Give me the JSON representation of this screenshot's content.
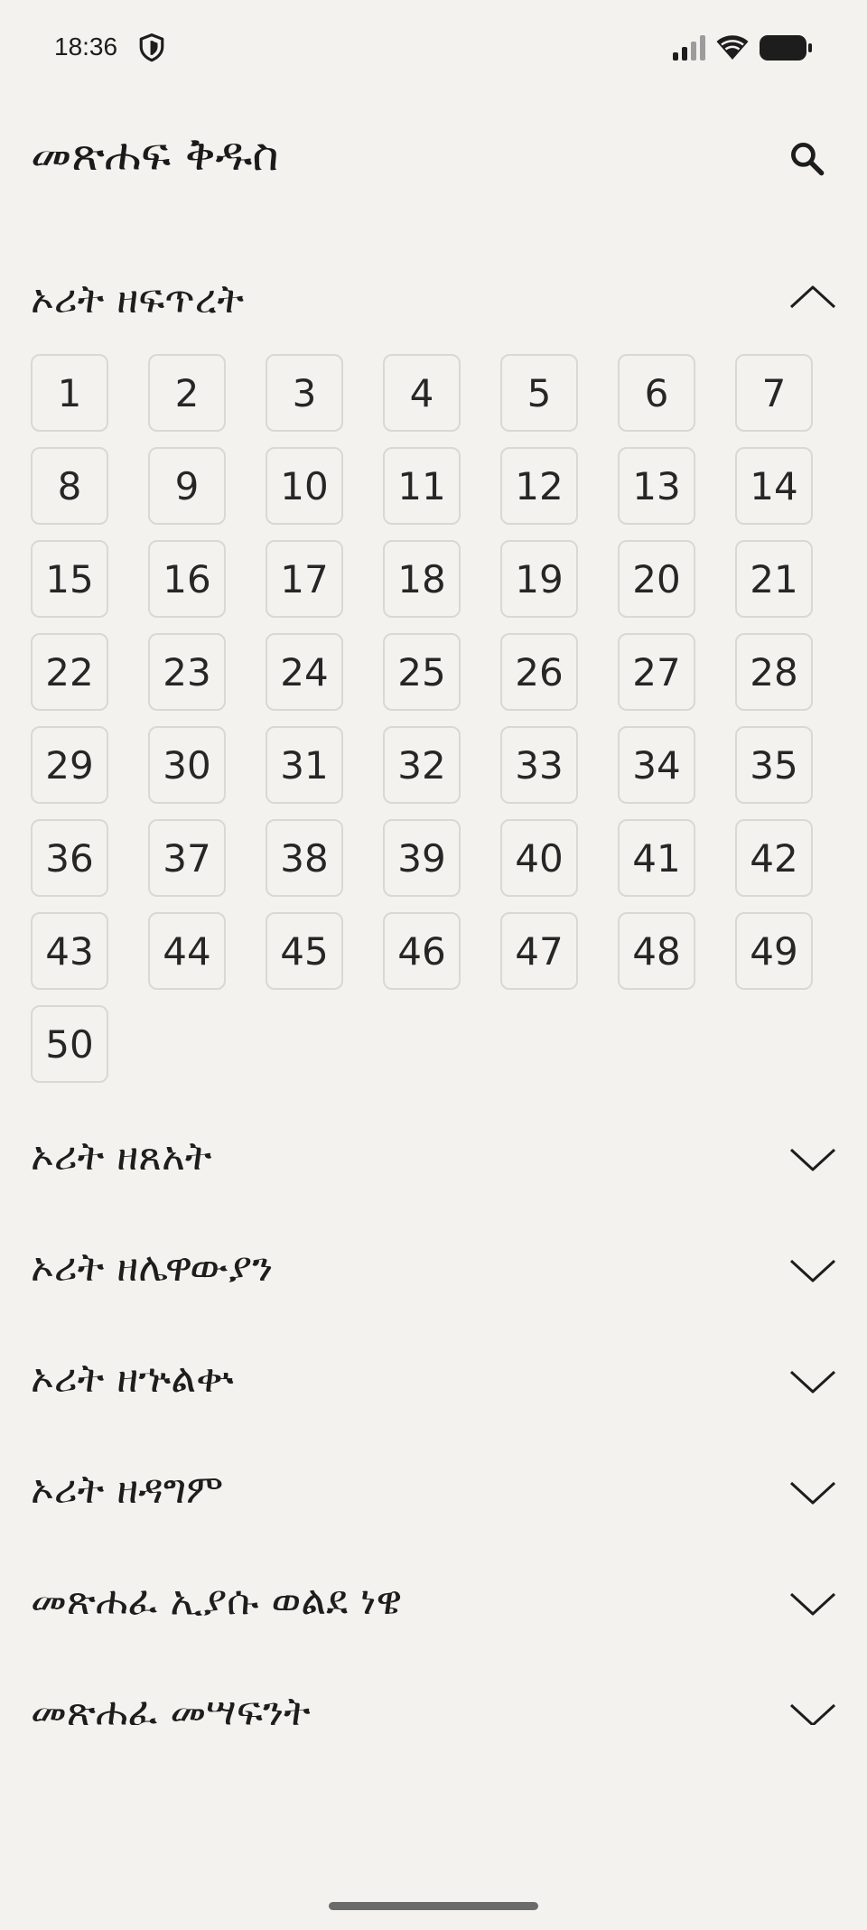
{
  "status_bar": {
    "time": "18:36",
    "icons": [
      "shield-icon",
      "signal-icon",
      "wifi-icon",
      "battery-icon"
    ]
  },
  "header": {
    "title": "መጽሐፍ ቅዱስ",
    "search_icon": "search-icon"
  },
  "books": [
    {
      "title": "ኦሪት ዘፍጥረት",
      "expanded": true,
      "chapters": [
        "1",
        "2",
        "3",
        "4",
        "5",
        "6",
        "7",
        "8",
        "9",
        "10",
        "11",
        "12",
        "13",
        "14",
        "15",
        "16",
        "17",
        "18",
        "19",
        "20",
        "21",
        "22",
        "23",
        "24",
        "25",
        "26",
        "27",
        "28",
        "29",
        "30",
        "31",
        "32",
        "33",
        "34",
        "35",
        "36",
        "37",
        "38",
        "39",
        "40",
        "41",
        "42",
        "43",
        "44",
        "45",
        "46",
        "47",
        "48",
        "49",
        "50"
      ]
    },
    {
      "title": "ኦሪት ዘጸአት",
      "expanded": false
    },
    {
      "title": "ኦሪት ዘሌዋውያን",
      "expanded": false
    },
    {
      "title": "ኦሪት ዘኍልቍ",
      "expanded": false
    },
    {
      "title": "ኦሪት ዘዳግም",
      "expanded": false
    },
    {
      "title": "መጽሐፈ ኢያሱ ወልደ ነዌ",
      "expanded": false
    },
    {
      "title": "መጽሐፈ መሣፍንት",
      "expanded": false
    }
  ],
  "colors": {
    "background": "#f3f2ef",
    "text": "#1d1d1d",
    "chapter_border": "#d9d8d4",
    "home_indicator": "#6b6b6b"
  }
}
